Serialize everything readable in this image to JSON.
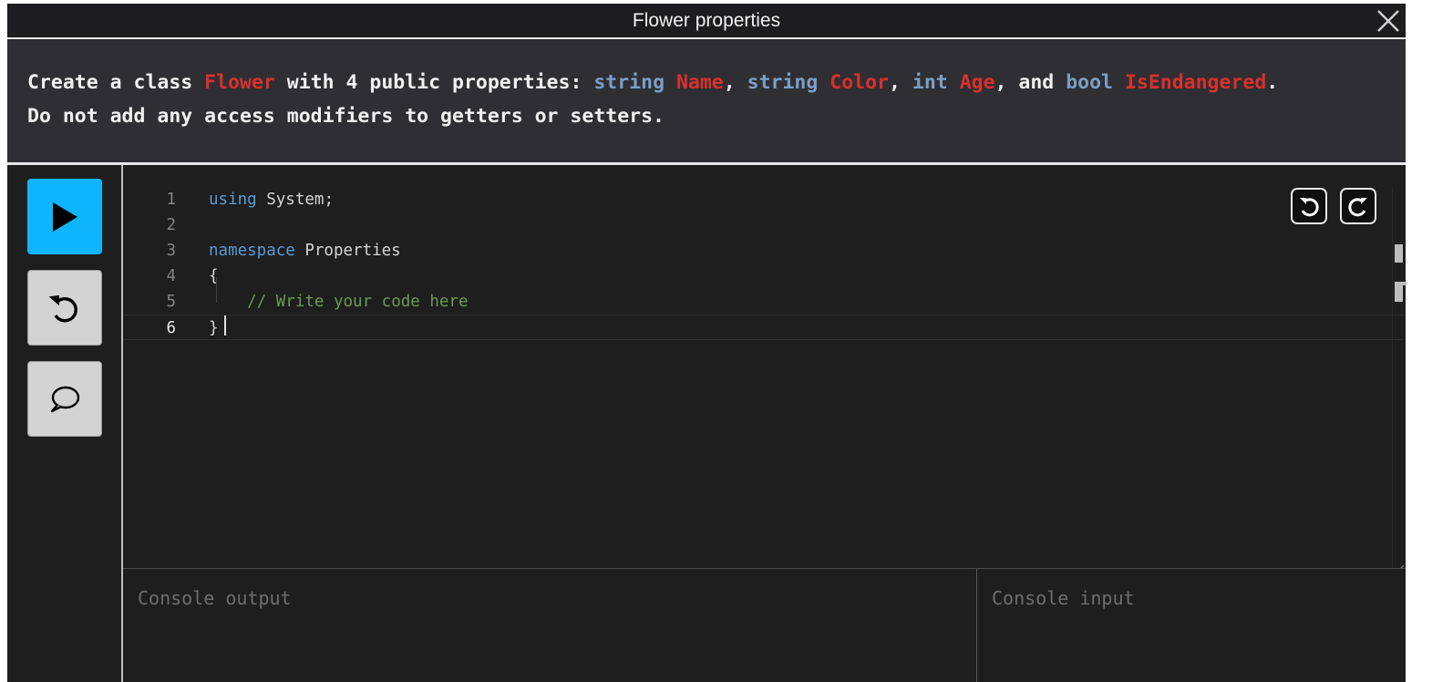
{
  "title": "Flower properties",
  "instructions": {
    "line1": [
      {
        "t": "Create a class ",
        "c": "plain"
      },
      {
        "t": "Flower",
        "c": "id"
      },
      {
        "t": " with 4 public properties: ",
        "c": "plain"
      },
      {
        "t": "string",
        "c": "kw"
      },
      {
        "t": " ",
        "c": "plain"
      },
      {
        "t": "Name",
        "c": "id"
      },
      {
        "t": ", ",
        "c": "plain"
      },
      {
        "t": "string",
        "c": "kw"
      },
      {
        "t": " ",
        "c": "plain"
      },
      {
        "t": "Color",
        "c": "id"
      },
      {
        "t": ", ",
        "c": "plain"
      },
      {
        "t": "int",
        "c": "kw"
      },
      {
        "t": " ",
        "c": "plain"
      },
      {
        "t": "Age",
        "c": "id"
      },
      {
        "t": ", and ",
        "c": "plain"
      },
      {
        "t": "bool",
        "c": "kw"
      },
      {
        "t": " ",
        "c": "plain"
      },
      {
        "t": "IsEndangered",
        "c": "id"
      },
      {
        "t": ".",
        "c": "plain"
      }
    ],
    "line2": "Do not add any access modifiers to getters or setters."
  },
  "editor": {
    "lines": [
      {
        "num": "1",
        "parts": [
          {
            "t": "using",
            "c": "code-kw"
          },
          {
            "t": " System;",
            "c": ""
          }
        ]
      },
      {
        "num": "2",
        "parts": []
      },
      {
        "num": "3",
        "parts": [
          {
            "t": "namespace",
            "c": "code-kw"
          },
          {
            "t": " Properties",
            "c": ""
          }
        ]
      },
      {
        "num": "4",
        "parts": [
          {
            "t": "{",
            "c": ""
          }
        ]
      },
      {
        "num": "5",
        "parts": [
          {
            "t": "    ",
            "c": ""
          },
          {
            "t": "// Write your code here",
            "c": "code-cm"
          }
        ]
      },
      {
        "num": "6",
        "parts": [
          {
            "t": "}",
            "c": ""
          }
        ]
      }
    ],
    "active_line": "6"
  },
  "console": {
    "output_placeholder": "Console output",
    "input_placeholder": "Console input"
  },
  "colors": {
    "accent": "#0fb5ff",
    "keyword": "#7a9fc7",
    "identifier": "#d9302c"
  }
}
